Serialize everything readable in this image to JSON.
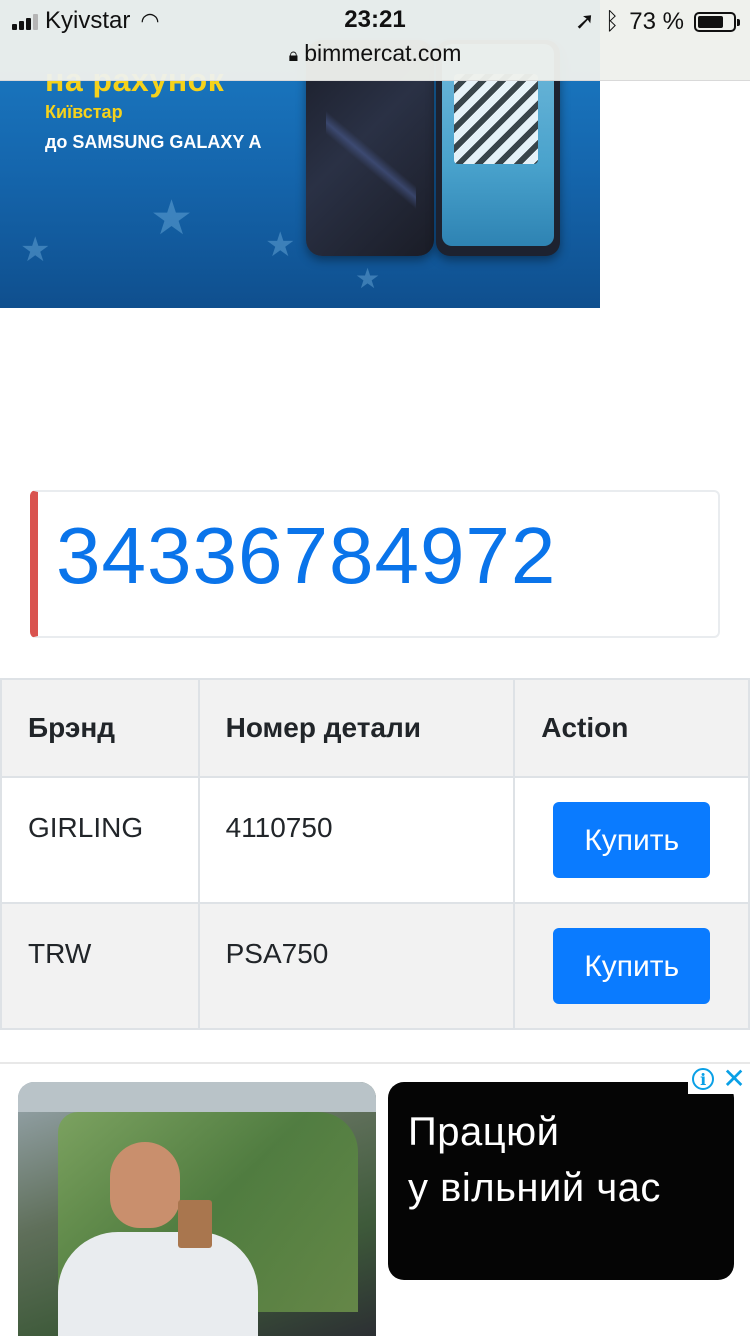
{
  "status_bar": {
    "carrier": "Kyivstar",
    "time": "23:21",
    "battery_percent_label": "73 %",
    "battery_level": 0.73,
    "url": "bimmercat.com"
  },
  "top_ad": {
    "headline": "на рахунок",
    "operator": "Київстар",
    "product": "до SAMSUNG GALAXY A"
  },
  "part_number": "34336784972",
  "table": {
    "headers": [
      "Брэнд",
      "Номер детали",
      "Action"
    ],
    "rows": [
      {
        "brand": "GIRLING",
        "part": "4110750",
        "action": "Купить"
      },
      {
        "brand": "TRW",
        "part": "PSA750",
        "action": "Купить"
      }
    ]
  },
  "bottom_ad": {
    "line1": "Працюй",
    "line2": "у вільний час"
  },
  "colors": {
    "link_blue": "#0a74ea",
    "button_blue": "#0a7bff",
    "card_accent": "#d9534f",
    "ad_yellow": "#f6d21b"
  }
}
